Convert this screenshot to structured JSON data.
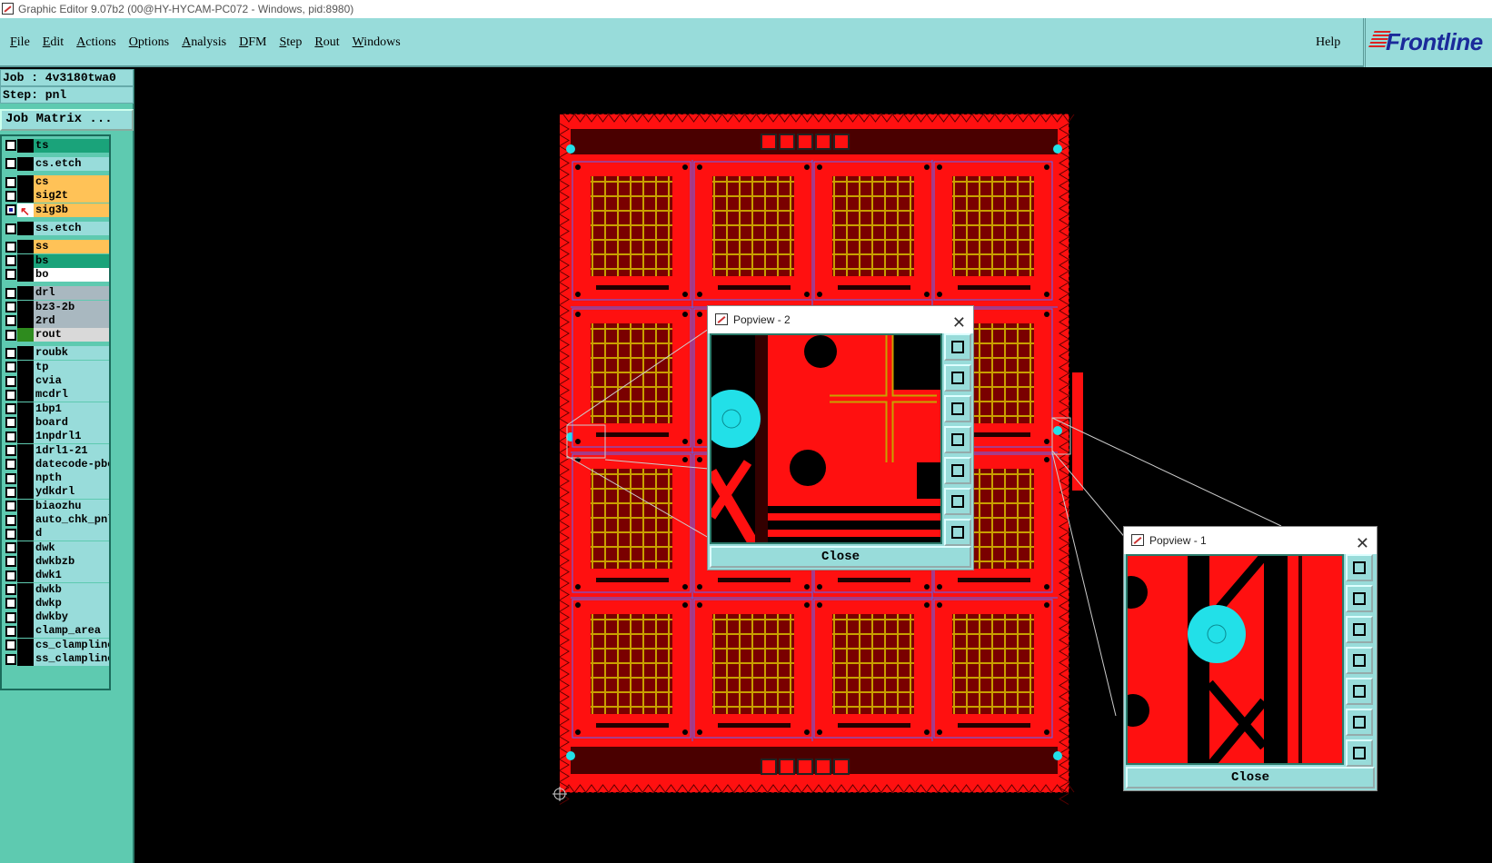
{
  "window": {
    "title": "Graphic Editor 9.07b2 (00@HY-HYCAM-PC072 - Windows, pid:8980)"
  },
  "menubar": {
    "items": [
      "File",
      "Edit",
      "Actions",
      "Options",
      "Analysis",
      "DFM",
      "Step",
      "Rout",
      "Windows"
    ],
    "help": "Help",
    "logo": "Frontline"
  },
  "sidebar": {
    "job": "Job : 4v3180twa0",
    "step": "Step: pnl",
    "job_matrix": "Job Matrix ...",
    "layers": [
      {
        "name": "ts",
        "color": "#1aa37a",
        "group": 0
      },
      {
        "name": "cs.etch",
        "color": "#98dcda",
        "group": 1
      },
      {
        "name": "cs",
        "color": "#ffc257",
        "group": 2
      },
      {
        "name": "sig2t",
        "color": "#ffc257",
        "group": 2
      },
      {
        "name": "sig3b",
        "color": "#ffc257",
        "group": 2,
        "active": true
      },
      {
        "name": "ss.etch",
        "color": "#98dcda",
        "group": 3
      },
      {
        "name": "ss",
        "color": "#ffc257",
        "group": 4
      },
      {
        "name": "bs",
        "color": "#1aa37a",
        "group": 4
      },
      {
        "name": "bo",
        "color": "#ffffff",
        "group": 4
      },
      {
        "name": "drl",
        "color": "#a9b8c0",
        "group": 5
      },
      {
        "name": "bz3-2b",
        "color": "#a9b8c0",
        "group": 5
      },
      {
        "name": "2rd",
        "color": "#a9b8c0",
        "group": 5
      },
      {
        "name": "rout",
        "color": "#d9d9d9",
        "group": 5,
        "swatch": "#2e8b1e"
      },
      {
        "name": "roubk",
        "color": "#98dcda",
        "group": 6
      },
      {
        "name": "tp",
        "color": "#98dcda",
        "group": 6
      },
      {
        "name": "cvia",
        "color": "#98dcda",
        "group": 6
      },
      {
        "name": "mcdrl",
        "color": "#98dcda",
        "group": 6
      },
      {
        "name": "1bp1",
        "color": "#98dcda",
        "group": 6
      },
      {
        "name": "board",
        "color": "#98dcda",
        "group": 6
      },
      {
        "name": "1npdrl1",
        "color": "#98dcda",
        "group": 6
      },
      {
        "name": "1drl1-21",
        "color": "#98dcda",
        "group": 6
      },
      {
        "name": "datecode-pbe",
        "color": "#98dcda",
        "group": 6
      },
      {
        "name": "npth",
        "color": "#98dcda",
        "group": 6
      },
      {
        "name": "ydkdrl",
        "color": "#98dcda",
        "group": 6
      },
      {
        "name": "biaozhu",
        "color": "#98dcda",
        "group": 6
      },
      {
        "name": "auto_chk_pnl",
        "color": "#98dcda",
        "group": 6
      },
      {
        "name": "d",
        "color": "#98dcda",
        "group": 6
      },
      {
        "name": "dwk",
        "color": "#98dcda",
        "group": 6
      },
      {
        "name": "dwkbzb",
        "color": "#98dcda",
        "group": 6
      },
      {
        "name": "dwk1",
        "color": "#98dcda",
        "group": 6
      },
      {
        "name": "dwkb",
        "color": "#98dcda",
        "group": 6
      },
      {
        "name": "dwkp",
        "color": "#98dcda",
        "group": 6
      },
      {
        "name": "dwkby",
        "color": "#98dcda",
        "group": 6
      },
      {
        "name": "clamp_area",
        "color": "#98dcda",
        "group": 6
      },
      {
        "name": "cs_clampline",
        "color": "#98dcda",
        "group": 6
      },
      {
        "name": "ss_clampline",
        "color": "#98dcda",
        "group": 6
      }
    ]
  },
  "popview2": {
    "title": "Popview - 2",
    "close_label": "Close"
  },
  "popview1": {
    "title": "Popview - 1",
    "close_label": "Close"
  },
  "colors": {
    "board": "#ff1010",
    "teal": "#98dcda",
    "cyan": "#22e0e8"
  }
}
